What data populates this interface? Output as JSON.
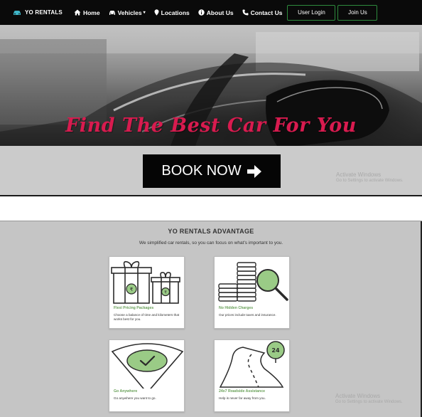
{
  "navbar": {
    "brand": "YO RENTALS",
    "brand_icon": "car-icon",
    "items": [
      {
        "label": "Home",
        "icon": "home-icon"
      },
      {
        "label": "Vehicles",
        "icon": "car-icon",
        "caret": "▾"
      },
      {
        "label": "Locations",
        "icon": "map-marker-icon"
      },
      {
        "label": "About Us",
        "icon": "info-circle-icon"
      },
      {
        "label": "Contact Us",
        "icon": "phone-icon"
      }
    ],
    "login_label": "User Login",
    "join_label": "Join Us",
    "button_border_color": "#2e8b3d"
  },
  "hero": {
    "title": "Find The Best Car For You",
    "title_color": "#d81b4f"
  },
  "book": {
    "label": "BOOK NOW",
    "icon": "arrow-right-icon"
  },
  "watermark": {
    "line1": "Activate Windows",
    "line2": "Go to Settings to activate Windows."
  },
  "advantage": {
    "title": "YO RENTALS ADVANTAGE",
    "subtitle": "We simplified car rentals, so you can focus on what's important to you.",
    "accent_color": "#6aa15a",
    "cards": [
      {
        "title": "Flexi Pricing Packages",
        "description": "Choose a balance of time and kilometers that works best for you.",
        "icon": "gift-boxes-icon"
      },
      {
        "title": "No Hidden Charges",
        "description": "Our prices include taxes and insurance.",
        "icon": "coins-magnifier-icon"
      },
      {
        "title": "Go Anywhere",
        "description": "Go anywhere you want to go.",
        "icon": "location-pin-check-icon"
      },
      {
        "title": "24x7 Roadside Assistance",
        "description": "Help is never far away from you.",
        "icon": "road-24-icon"
      }
    ]
  }
}
